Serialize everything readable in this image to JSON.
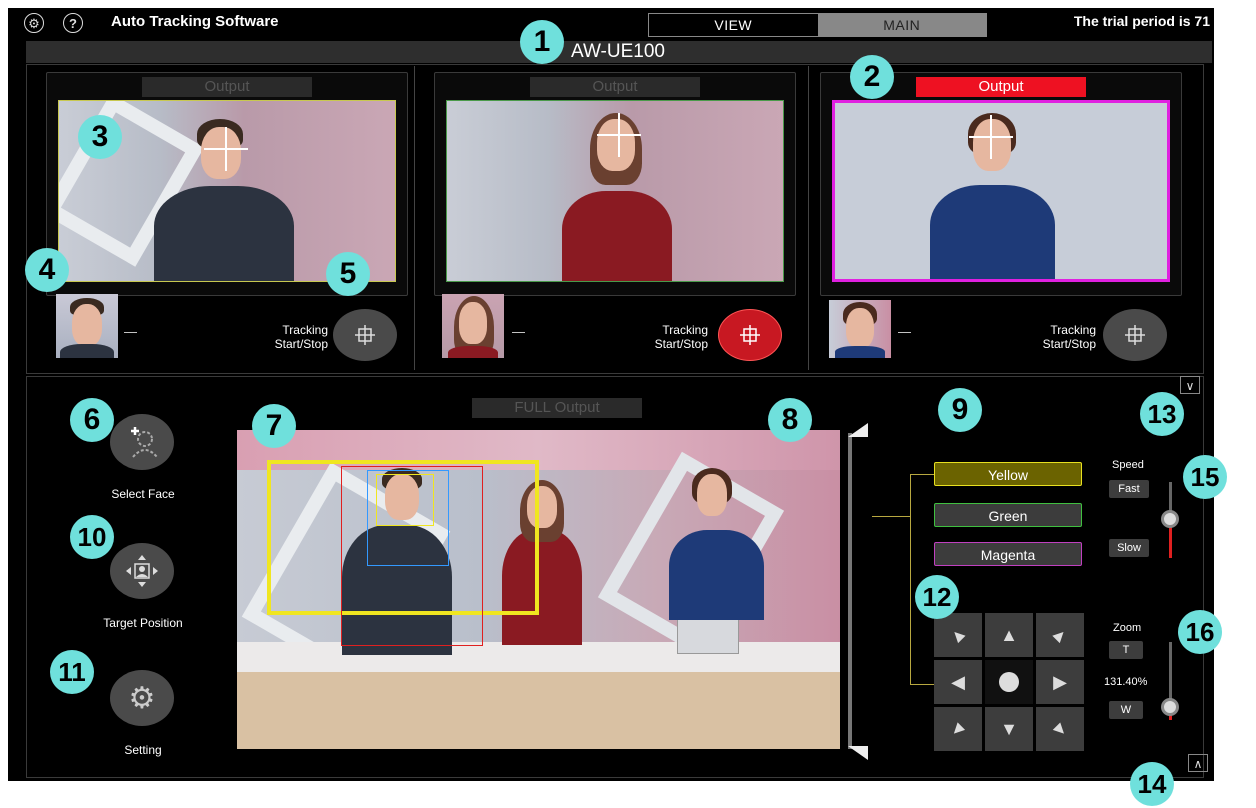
{
  "header": {
    "app_title": "Auto Tracking Software",
    "tabs": [
      {
        "label": "VIEW",
        "active": false
      },
      {
        "label": "MAIN",
        "active": true
      }
    ],
    "trial_notice": "The trial period is 71",
    "camera_model": "AW-UE100",
    "icons": [
      "settings-icon",
      "help-icon"
    ]
  },
  "cameras": [
    {
      "output_label": "Output",
      "output_active": false,
      "frame_color": "#c8c850",
      "dash": "—",
      "tracking_label_1": "Tracking",
      "tracking_label_2": "Start/Stop",
      "tracking_active": false
    },
    {
      "output_label": "Output",
      "output_active": false,
      "frame_color": "#4a9a4a",
      "dash": "—",
      "tracking_label_1": "Tracking",
      "tracking_label_2": "Start/Stop",
      "tracking_active": true
    },
    {
      "output_label": "Output",
      "output_active": true,
      "frame_color": "#e020e0",
      "dash": "—",
      "tracking_label_1": "Tracking",
      "tracking_label_2": "Start/Stop",
      "tracking_active": false
    }
  ],
  "main": {
    "full_output_label": "FULL Output",
    "side_buttons": [
      {
        "label": "Select Face",
        "icon": "select-face-icon"
      },
      {
        "label": "Target Position",
        "icon": "target-position-icon"
      },
      {
        "label": "Setting",
        "icon": "gear-icon"
      }
    ],
    "color_buttons": [
      {
        "label": "Yellow",
        "bg": "#6b6300",
        "border": "#e8e020"
      },
      {
        "label": "Green",
        "bg": "#3c3c3c",
        "border": "#40c040"
      },
      {
        "label": "Magenta",
        "bg": "#3c3c3c",
        "border": "#c040c0"
      }
    ],
    "speed": {
      "label": "Speed",
      "fast": "Fast",
      "slow": "Slow"
    },
    "zoom": {
      "label": "Zoom",
      "tele": "T",
      "wide": "W",
      "value": "131.40%"
    }
  },
  "callouts": [
    "1",
    "2",
    "3",
    "4",
    "5",
    "6",
    "7",
    "8",
    "9",
    "10",
    "11",
    "12",
    "13",
    "14",
    "15",
    "16"
  ]
}
